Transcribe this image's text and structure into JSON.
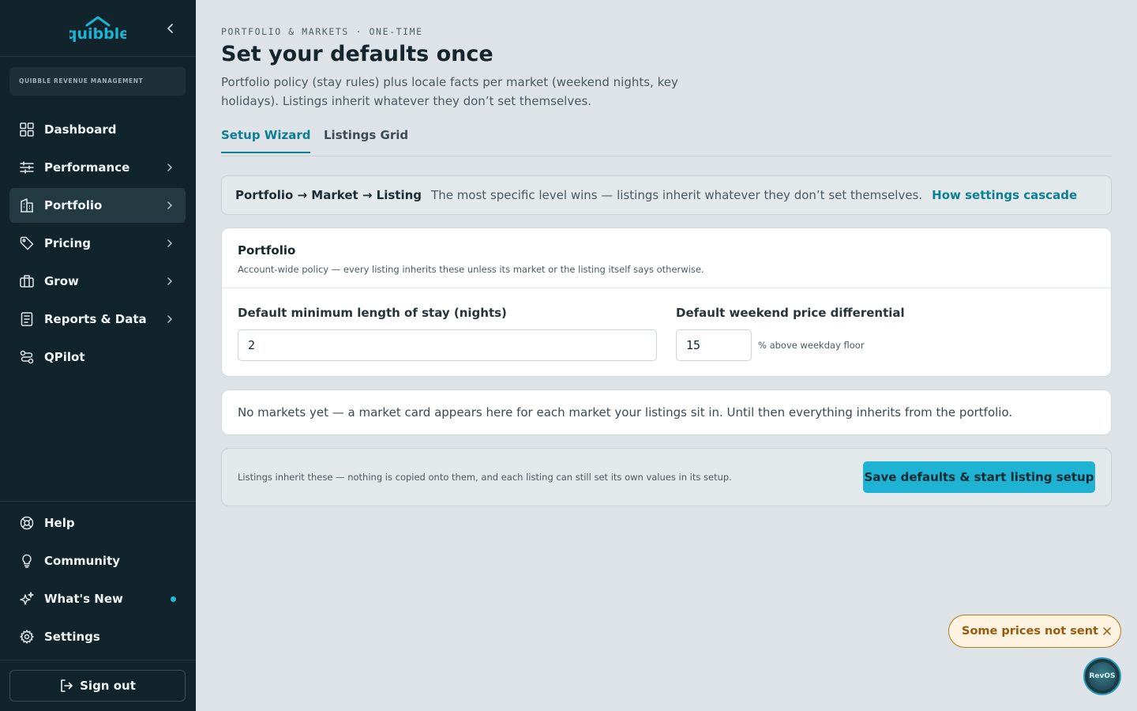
{
  "app": {
    "logo_text": "quibble",
    "brand_label": "QUIBBLE REVENUE MANAGEMENT"
  },
  "sidebar": {
    "main_items": [
      {
        "label": "Dashboard",
        "icon": "grid-icon",
        "has_chevron": false,
        "active": false
      },
      {
        "label": "Performance",
        "icon": "sliders-icon",
        "has_chevron": true,
        "active": false
      },
      {
        "label": "Portfolio",
        "icon": "building-icon",
        "has_chevron": true,
        "active": true
      },
      {
        "label": "Pricing",
        "icon": "tag-icon",
        "has_chevron": true,
        "active": false
      },
      {
        "label": "Grow",
        "icon": "briefcase-icon",
        "has_chevron": true,
        "active": false
      },
      {
        "label": "Reports & Data",
        "icon": "report-icon",
        "has_chevron": true,
        "active": false
      },
      {
        "label": "QPilot",
        "icon": "route-icon",
        "has_chevron": false,
        "active": false
      }
    ],
    "bottom_items": [
      {
        "label": "Help",
        "icon": "lifebuoy-icon"
      },
      {
        "label": "Community",
        "icon": "lightbulb-icon"
      },
      {
        "label": "What's New",
        "icon": "sparkles-icon",
        "has_dot": true
      },
      {
        "label": "Settings",
        "icon": "gear-icon"
      }
    ],
    "sign_out": "Sign out"
  },
  "header": {
    "eyebrow": "PORTFOLIO & MARKETS · ONE-TIME",
    "title": "Set your defaults once",
    "subtitle": "Portfolio policy (stay rules) plus locale facts per market (weekend nights, key holidays). Listings inherit whatever they don’t set themselves."
  },
  "tabs": [
    {
      "label": "Setup Wizard",
      "active": true
    },
    {
      "label": "Listings Grid",
      "active": false
    }
  ],
  "cascade": {
    "path": "Portfolio → Market → Listing",
    "description": "The most specific level wins — listings inherit whatever they don’t set themselves.",
    "link": "How settings cascade"
  },
  "portfolio_card": {
    "title": "Portfolio",
    "subtitle": "Account-wide policy — every listing inherits these unless its market or the listing itself says otherwise.",
    "min_stay_label": "Default minimum length of stay (nights)",
    "min_stay_value": "2",
    "weekend_label": "Default weekend price differential",
    "weekend_value": "15",
    "weekend_suffix": "% above weekday floor"
  },
  "markets_empty": "No markets yet — a market card appears here for each market your listings sit in. Until then everything inherits from the portfolio.",
  "footer": {
    "note": "Listings inherit these — nothing is copied onto them, and each listing can still set its own values in its setup.",
    "save_label": "Save defaults & start listing setup"
  },
  "toast": {
    "text": "Some prices not sent"
  },
  "fab": {
    "label": "RevOS"
  },
  "colors": {
    "accent": "#1fb3d3",
    "link": "#0d7f92",
    "sidebar_bg": "#12242b",
    "warning": "#9a5a0e"
  }
}
